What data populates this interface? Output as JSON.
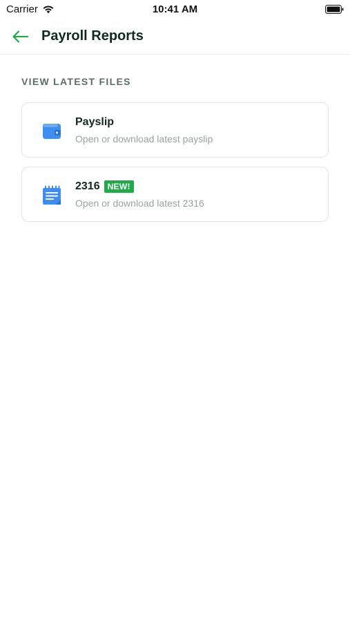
{
  "status_bar": {
    "carrier": "Carrier",
    "time": "10:41 AM"
  },
  "header": {
    "title": "Payroll Reports",
    "back_icon": "arrow-left-icon",
    "accent_color": "#22a94a"
  },
  "section": {
    "heading": "VIEW LATEST FILES"
  },
  "cards": [
    {
      "title": "Payslip",
      "subtitle": "Open or download latest payslip",
      "icon": "wallet-icon",
      "badge": ""
    },
    {
      "title": "2316",
      "subtitle": "Open or download latest 2316",
      "icon": "notepad-icon",
      "badge": "NEW!"
    }
  ],
  "colors": {
    "icon_blue": "#3d8ef0",
    "badge_green": "#22a94a"
  }
}
